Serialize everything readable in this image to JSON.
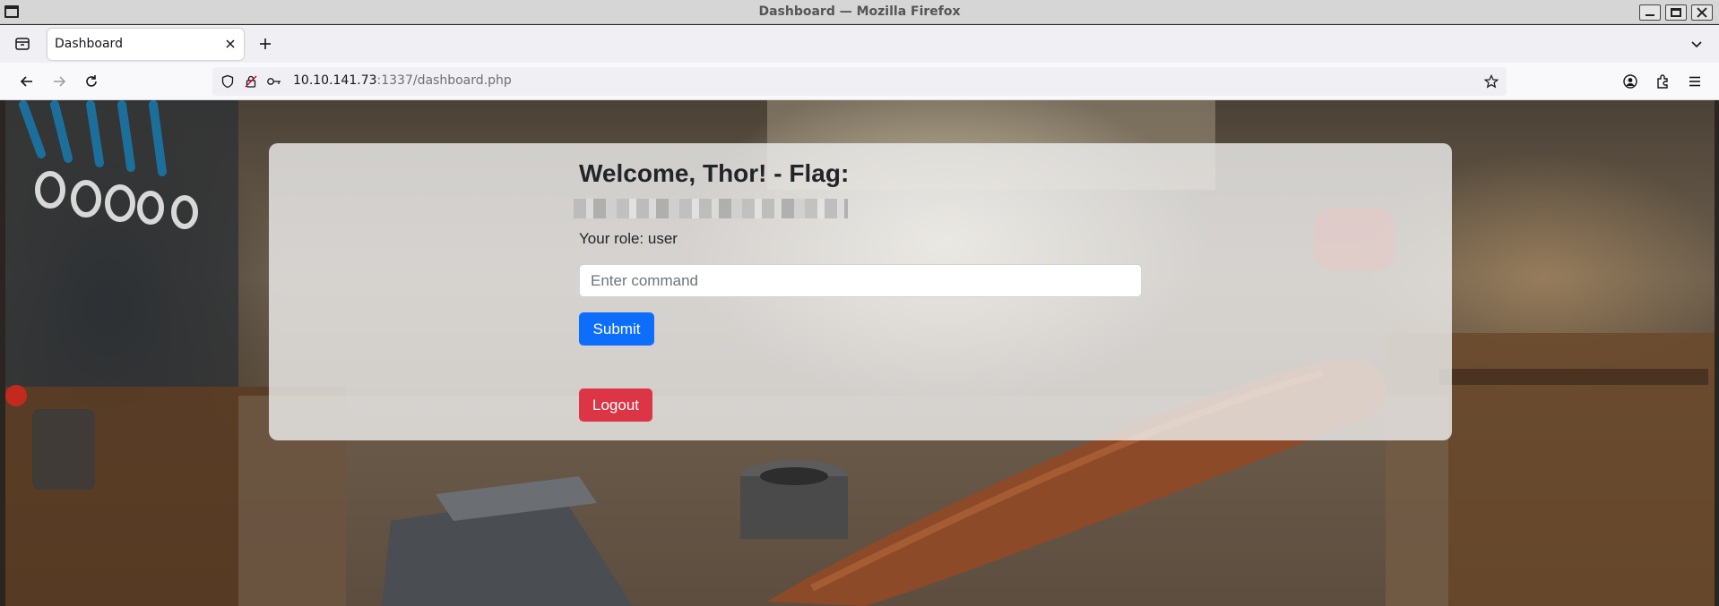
{
  "window": {
    "title": "Dashboard — Mozilla Firefox"
  },
  "tabs": [
    {
      "label": "Dashboard",
      "active": true
    }
  ],
  "urlbar": {
    "host": "10.10.141.73",
    "rest": ":1337/dashboard.php"
  },
  "page": {
    "welcome": "Welcome, Thor! - Flag:",
    "flag_redacted": true,
    "role": "Your role: user",
    "command_placeholder": "Enter command",
    "command_value": "",
    "submit_label": "Submit",
    "logout_label": "Logout"
  },
  "colors": {
    "submit": "#0d6efd",
    "logout": "#dc3545",
    "card": "rgba(240,240,240,0.80)"
  },
  "icons": {
    "tabs_list": "tabs-list-icon",
    "tab_close": "close-icon",
    "new_tab": "plus-icon",
    "overflow": "chevron-down-icon",
    "back": "back-arrow-icon",
    "forward": "forward-arrow-icon",
    "reload": "reload-icon",
    "shield": "shield-icon",
    "permissions": "permissions-icon",
    "key": "key-icon",
    "bookmark": "star-icon",
    "account": "account-icon",
    "extensions": "extensions-icon",
    "menu": "hamburger-menu-icon"
  }
}
